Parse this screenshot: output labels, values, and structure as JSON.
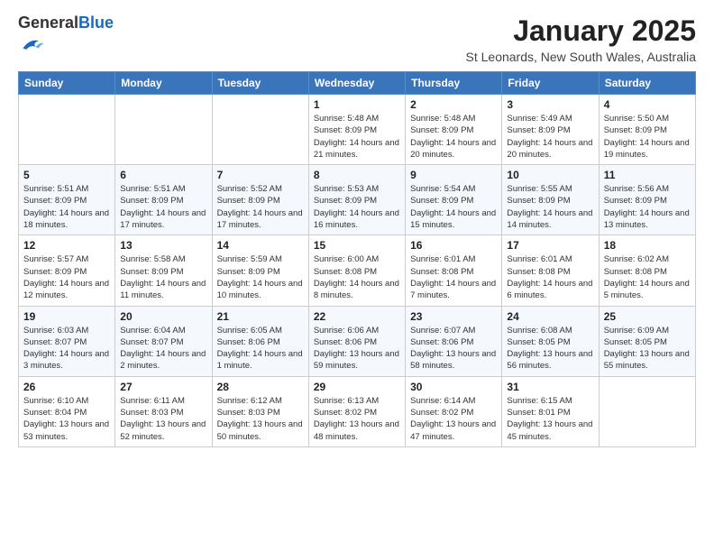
{
  "header": {
    "logo": {
      "general": "General",
      "blue": "Blue"
    },
    "title": "January 2025",
    "location": "St Leonards, New South Wales, Australia"
  },
  "weekdays": [
    "Sunday",
    "Monday",
    "Tuesday",
    "Wednesday",
    "Thursday",
    "Friday",
    "Saturday"
  ],
  "weeks": [
    [
      {
        "day": "",
        "info": ""
      },
      {
        "day": "",
        "info": ""
      },
      {
        "day": "",
        "info": ""
      },
      {
        "day": "1",
        "info": "Sunrise: 5:48 AM\nSunset: 8:09 PM\nDaylight: 14 hours\nand 21 minutes."
      },
      {
        "day": "2",
        "info": "Sunrise: 5:48 AM\nSunset: 8:09 PM\nDaylight: 14 hours\nand 20 minutes."
      },
      {
        "day": "3",
        "info": "Sunrise: 5:49 AM\nSunset: 8:09 PM\nDaylight: 14 hours\nand 20 minutes."
      },
      {
        "day": "4",
        "info": "Sunrise: 5:50 AM\nSunset: 8:09 PM\nDaylight: 14 hours\nand 19 minutes."
      }
    ],
    [
      {
        "day": "5",
        "info": "Sunrise: 5:51 AM\nSunset: 8:09 PM\nDaylight: 14 hours\nand 18 minutes."
      },
      {
        "day": "6",
        "info": "Sunrise: 5:51 AM\nSunset: 8:09 PM\nDaylight: 14 hours\nand 17 minutes."
      },
      {
        "day": "7",
        "info": "Sunrise: 5:52 AM\nSunset: 8:09 PM\nDaylight: 14 hours\nand 17 minutes."
      },
      {
        "day": "8",
        "info": "Sunrise: 5:53 AM\nSunset: 8:09 PM\nDaylight: 14 hours\nand 16 minutes."
      },
      {
        "day": "9",
        "info": "Sunrise: 5:54 AM\nSunset: 8:09 PM\nDaylight: 14 hours\nand 15 minutes."
      },
      {
        "day": "10",
        "info": "Sunrise: 5:55 AM\nSunset: 8:09 PM\nDaylight: 14 hours\nand 14 minutes."
      },
      {
        "day": "11",
        "info": "Sunrise: 5:56 AM\nSunset: 8:09 PM\nDaylight: 14 hours\nand 13 minutes."
      }
    ],
    [
      {
        "day": "12",
        "info": "Sunrise: 5:57 AM\nSunset: 8:09 PM\nDaylight: 14 hours\nand 12 minutes."
      },
      {
        "day": "13",
        "info": "Sunrise: 5:58 AM\nSunset: 8:09 PM\nDaylight: 14 hours\nand 11 minutes."
      },
      {
        "day": "14",
        "info": "Sunrise: 5:59 AM\nSunset: 8:09 PM\nDaylight: 14 hours\nand 10 minutes."
      },
      {
        "day": "15",
        "info": "Sunrise: 6:00 AM\nSunset: 8:08 PM\nDaylight: 14 hours\nand 8 minutes."
      },
      {
        "day": "16",
        "info": "Sunrise: 6:01 AM\nSunset: 8:08 PM\nDaylight: 14 hours\nand 7 minutes."
      },
      {
        "day": "17",
        "info": "Sunrise: 6:01 AM\nSunset: 8:08 PM\nDaylight: 14 hours\nand 6 minutes."
      },
      {
        "day": "18",
        "info": "Sunrise: 6:02 AM\nSunset: 8:08 PM\nDaylight: 14 hours\nand 5 minutes."
      }
    ],
    [
      {
        "day": "19",
        "info": "Sunrise: 6:03 AM\nSunset: 8:07 PM\nDaylight: 14 hours\nand 3 minutes."
      },
      {
        "day": "20",
        "info": "Sunrise: 6:04 AM\nSunset: 8:07 PM\nDaylight: 14 hours\nand 2 minutes."
      },
      {
        "day": "21",
        "info": "Sunrise: 6:05 AM\nSunset: 8:06 PM\nDaylight: 14 hours\nand 1 minute."
      },
      {
        "day": "22",
        "info": "Sunrise: 6:06 AM\nSunset: 8:06 PM\nDaylight: 13 hours\nand 59 minutes."
      },
      {
        "day": "23",
        "info": "Sunrise: 6:07 AM\nSunset: 8:06 PM\nDaylight: 13 hours\nand 58 minutes."
      },
      {
        "day": "24",
        "info": "Sunrise: 6:08 AM\nSunset: 8:05 PM\nDaylight: 13 hours\nand 56 minutes."
      },
      {
        "day": "25",
        "info": "Sunrise: 6:09 AM\nSunset: 8:05 PM\nDaylight: 13 hours\nand 55 minutes."
      }
    ],
    [
      {
        "day": "26",
        "info": "Sunrise: 6:10 AM\nSunset: 8:04 PM\nDaylight: 13 hours\nand 53 minutes."
      },
      {
        "day": "27",
        "info": "Sunrise: 6:11 AM\nSunset: 8:03 PM\nDaylight: 13 hours\nand 52 minutes."
      },
      {
        "day": "28",
        "info": "Sunrise: 6:12 AM\nSunset: 8:03 PM\nDaylight: 13 hours\nand 50 minutes."
      },
      {
        "day": "29",
        "info": "Sunrise: 6:13 AM\nSunset: 8:02 PM\nDaylight: 13 hours\nand 48 minutes."
      },
      {
        "day": "30",
        "info": "Sunrise: 6:14 AM\nSunset: 8:02 PM\nDaylight: 13 hours\nand 47 minutes."
      },
      {
        "day": "31",
        "info": "Sunrise: 6:15 AM\nSunset: 8:01 PM\nDaylight: 13 hours\nand 45 minutes."
      },
      {
        "day": "",
        "info": ""
      }
    ]
  ]
}
